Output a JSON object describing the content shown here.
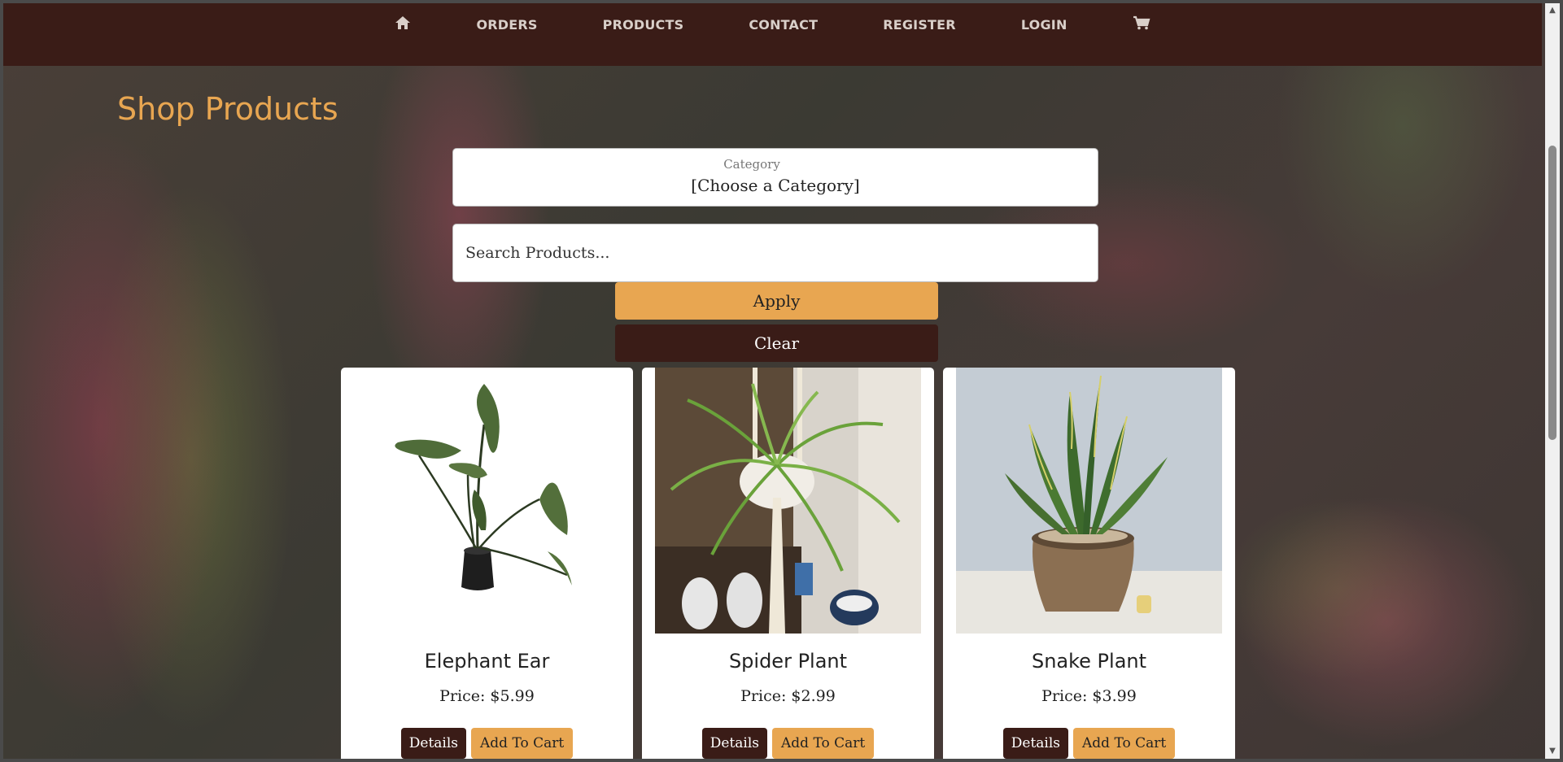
{
  "nav": {
    "home_icon": "home-icon",
    "items": [
      "ORDERS",
      "PRODUCTS",
      "CONTACT",
      "REGISTER",
      "LOGIN"
    ],
    "cart_icon": "cart-icon"
  },
  "page": {
    "title": "Shop Products"
  },
  "filters": {
    "category_label": "Category",
    "category_value": "[Choose a Category]",
    "search_placeholder": "Search Products...",
    "apply_label": "Apply",
    "clear_label": "Clear"
  },
  "products": [
    {
      "name": "Elephant Ear",
      "price": "Price: $5.99",
      "details_label": "Details",
      "cart_label": "Add To Cart"
    },
    {
      "name": "Spider Plant",
      "price": "Price: $2.99",
      "details_label": "Details",
      "cart_label": "Add To Cart"
    },
    {
      "name": "Snake Plant",
      "price": "Price: $3.99",
      "details_label": "Details",
      "cart_label": "Add To Cart"
    }
  ],
  "colors": {
    "primary_dark": "#3a1c17",
    "accent": "#e8a651"
  }
}
